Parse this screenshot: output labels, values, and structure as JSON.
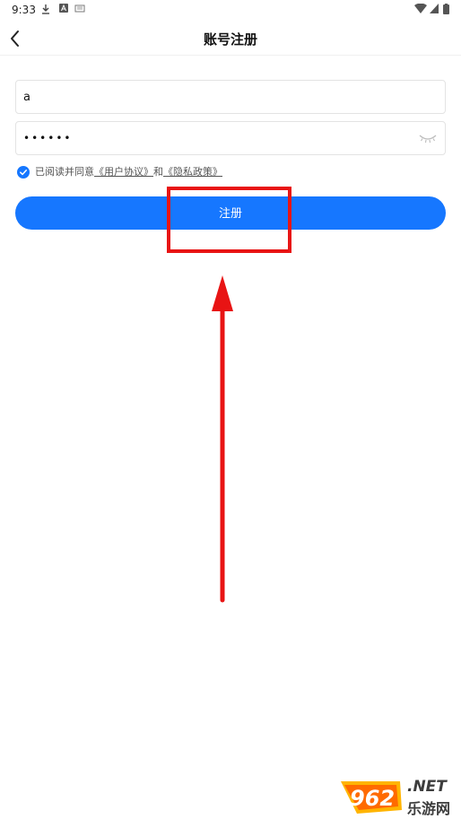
{
  "status_bar": {
    "time": "9:33",
    "left_icons": [
      "download-icon",
      "app-a-icon",
      "notification-icon"
    ],
    "right_icons": [
      "wifi-icon",
      "signal-icon",
      "battery-icon"
    ]
  },
  "nav": {
    "back_icon": "chevron-left-icon",
    "title": "账号注册"
  },
  "form": {
    "account_value": "a",
    "password_value": "••••••",
    "eye_icon": "eye-closed-icon"
  },
  "agreement": {
    "checked": true,
    "prefix": "已阅读并同意",
    "user_agreement": "《用户协议》",
    "and": "和",
    "privacy_policy": "《隐私政策》"
  },
  "register_button": {
    "label": "注册"
  },
  "annotation": {
    "highlight_color": "#e81414",
    "arrow_color": "#e81414"
  },
  "watermark": {
    "logo": "962",
    "suffix": ".NET",
    "site_name": "乐游网"
  },
  "colors": {
    "primary": "#1677ff",
    "annotation_red": "#e81414"
  }
}
